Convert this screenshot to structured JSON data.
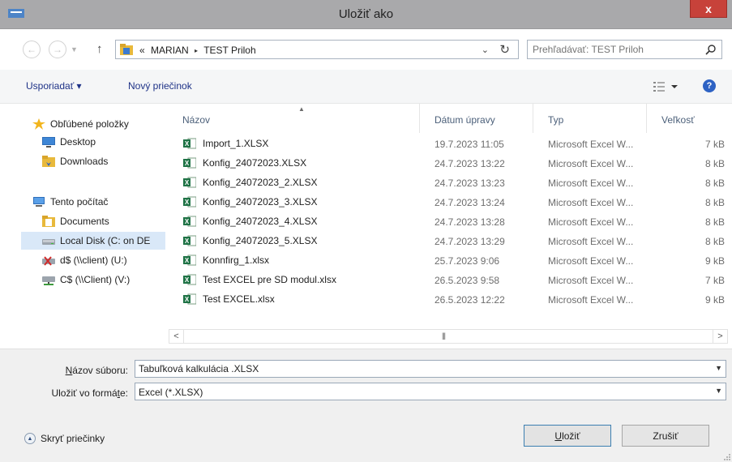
{
  "window": {
    "title": "Uložiť ako",
    "close_label": "x"
  },
  "address": {
    "crumbs": [
      "«",
      "MARIAN",
      "TEST Priloh"
    ],
    "separator": "▸"
  },
  "search": {
    "placeholder": "Prehľadávať: TEST Priloh"
  },
  "toolbar": {
    "organize": "Usporiadať ▾",
    "new_folder": "Nový priečinok",
    "help": "?"
  },
  "nav": {
    "items": [
      {
        "label": "Obľúbené položky",
        "icon": "star-icon"
      },
      {
        "label": "Desktop",
        "icon": "desktop-icon"
      },
      {
        "label": "Downloads",
        "icon": "downloads-folder-icon"
      },
      {
        "label": "Tento počítač",
        "icon": "computer-icon"
      },
      {
        "label": "Documents",
        "icon": "documents-folder-icon"
      },
      {
        "label": "Local Disk (C: on DE",
        "icon": "drive-icon"
      },
      {
        "label": "d$ (\\\\client) (U:)",
        "icon": "disconnected-drive-icon"
      },
      {
        "label": "C$ (\\\\Client) (V:)",
        "icon": "network-drive-icon"
      }
    ]
  },
  "files": {
    "columns": {
      "name": "Názov",
      "date": "Dátum úpravy",
      "type": "Typ",
      "size": "Veľkosť"
    },
    "rows": [
      {
        "name": "Import_1.XLSX",
        "date": "19.7.2023 11:05",
        "type": "Microsoft Excel W...",
        "size": "7 kB"
      },
      {
        "name": "Konfig_24072023.XLSX",
        "date": "24.7.2023 13:22",
        "type": "Microsoft Excel W...",
        "size": "8 kB"
      },
      {
        "name": "Konfig_24072023_2.XLSX",
        "date": "24.7.2023 13:23",
        "type": "Microsoft Excel W...",
        "size": "8 kB"
      },
      {
        "name": "Konfig_24072023_3.XLSX",
        "date": "24.7.2023 13:24",
        "type": "Microsoft Excel W...",
        "size": "8 kB"
      },
      {
        "name": "Konfig_24072023_4.XLSX",
        "date": "24.7.2023 13:28",
        "type": "Microsoft Excel W...",
        "size": "8 kB"
      },
      {
        "name": "Konfig_24072023_5.XLSX",
        "date": "24.7.2023 13:29",
        "type": "Microsoft Excel W...",
        "size": "8 kB"
      },
      {
        "name": "Konnfirg_1.xlsx",
        "date": "25.7.2023 9:06",
        "type": "Microsoft Excel W...",
        "size": "9 kB"
      },
      {
        "name": "Test EXCEL  pre SD modul.xlsx",
        "date": "26.5.2023 9:58",
        "type": "Microsoft Excel W...",
        "size": "7 kB"
      },
      {
        "name": "Test EXCEL.xlsx",
        "date": "26.5.2023 12:22",
        "type": "Microsoft Excel W...",
        "size": "9 kB"
      }
    ]
  },
  "form": {
    "filename_label_prefix": "N",
    "filename_label_rest": "ázov súboru:",
    "filename_value": "Tabuľková kalkulácia .XLSX",
    "format_label_prefix": "Uložiť vo formá",
    "format_label_u": "t",
    "format_label_rest": "e:",
    "format_value": "Excel (*.XLSX)"
  },
  "footer": {
    "hide_folders": "Skryť priečinky",
    "save_u": "U",
    "save_rest": "ložiť",
    "cancel": "Zrušiť"
  },
  "colors": {
    "titlebar": "#a9a9ab",
    "close": "#c7423a",
    "link": "#1e3287",
    "selected": "#d9e8f8",
    "excel_green": "#1f7346"
  }
}
